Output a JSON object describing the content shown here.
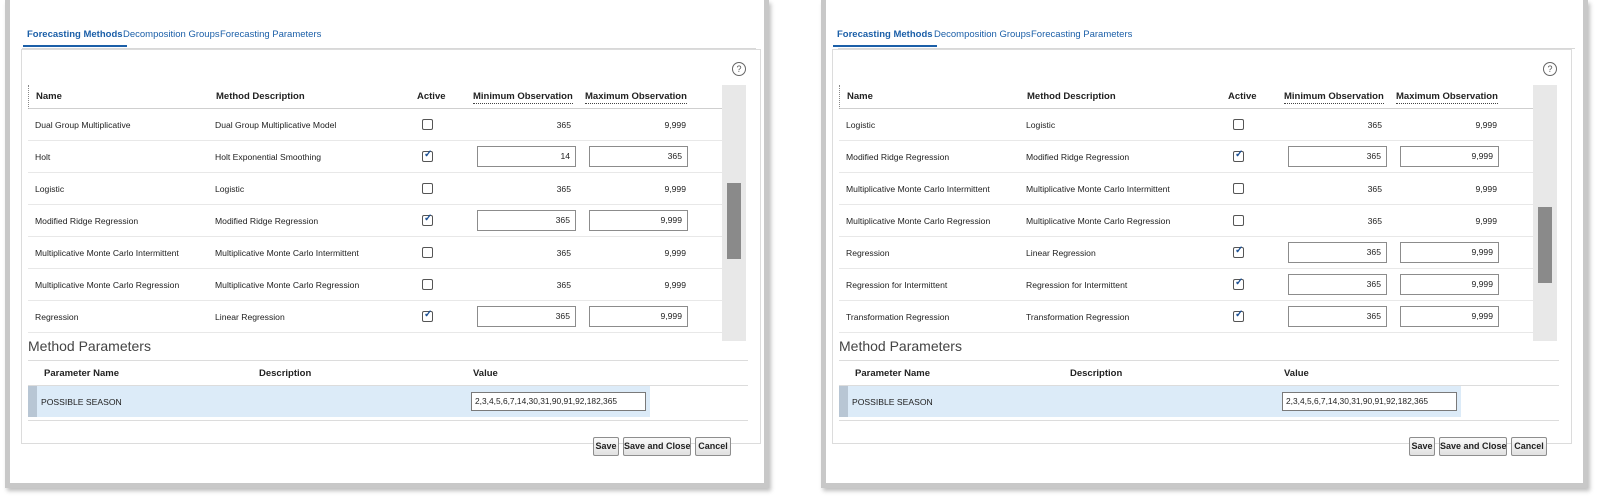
{
  "tabs": [
    "Forecasting Methods",
    "Decomposition Groups",
    "Forecasting Parameters"
  ],
  "help_icon": "?",
  "columns": {
    "name": "Name",
    "description": "Method Description",
    "active": "Active",
    "min_obs": "Minimum Observation",
    "max_obs": "Maximum Observation"
  },
  "left_rows": [
    {
      "name": "Dual Group Multiplicative",
      "description": "Dual Group Multiplicative Model",
      "active": false,
      "min": "365",
      "max": "9,999"
    },
    {
      "name": "Holt",
      "description": "Holt Exponential Smoothing",
      "active": true,
      "min": "14",
      "max": "365"
    },
    {
      "name": "Logistic",
      "description": "Logistic",
      "active": false,
      "min": "365",
      "max": "9,999"
    },
    {
      "name": "Modified Ridge Regression",
      "description": "Modified Ridge Regression",
      "active": true,
      "min": "365",
      "max": "9,999"
    },
    {
      "name": "Multiplicative Monte Carlo Intermittent",
      "description": "Multiplicative Monte Carlo Intermittent",
      "active": false,
      "min": "365",
      "max": "9,999"
    },
    {
      "name": "Multiplicative Monte Carlo Regression",
      "description": "Multiplicative Monte Carlo Regression",
      "active": false,
      "min": "365",
      "max": "9,999"
    },
    {
      "name": "Regression",
      "description": "Linear Regression",
      "active": true,
      "min": "365",
      "max": "9,999"
    }
  ],
  "right_rows": [
    {
      "name": "Logistic",
      "description": "Logistic",
      "active": false,
      "min": "365",
      "max": "9,999"
    },
    {
      "name": "Modified Ridge Regression",
      "description": "Modified Ridge Regression",
      "active": true,
      "min": "365",
      "max": "9,999"
    },
    {
      "name": "Multiplicative Monte Carlo Intermittent",
      "description": "Multiplicative Monte Carlo Intermittent",
      "active": false,
      "min": "365",
      "max": "9,999"
    },
    {
      "name": "Multiplicative Monte Carlo Regression",
      "description": "Multiplicative Monte Carlo Regression",
      "active": false,
      "min": "365",
      "max": "9,999"
    },
    {
      "name": "Regression",
      "description": "Linear Regression",
      "active": true,
      "min": "365",
      "max": "9,999"
    },
    {
      "name": "Regression for Intermittent",
      "description": "Regression for Intermittent",
      "active": true,
      "min": "365",
      "max": "9,999"
    },
    {
      "name": "Transformation Regression",
      "description": "Transformation Regression",
      "active": true,
      "min": "365",
      "max": "9,999"
    }
  ],
  "method_parameters": {
    "title": "Method Parameters",
    "col_name": "Parameter Name",
    "col_description": "Description",
    "col_value": "Value",
    "row_name": "POSSIBLE SEASON",
    "row_value": "2,3,4,5,6,7,14,30,31,90,91,92,182,365"
  },
  "buttons": {
    "save": "Save",
    "save_close": "Save and Close",
    "cancel": "Cancel"
  },
  "colors": {
    "accent": "#1b5fa8",
    "selected_row": "#dcebf8"
  }
}
